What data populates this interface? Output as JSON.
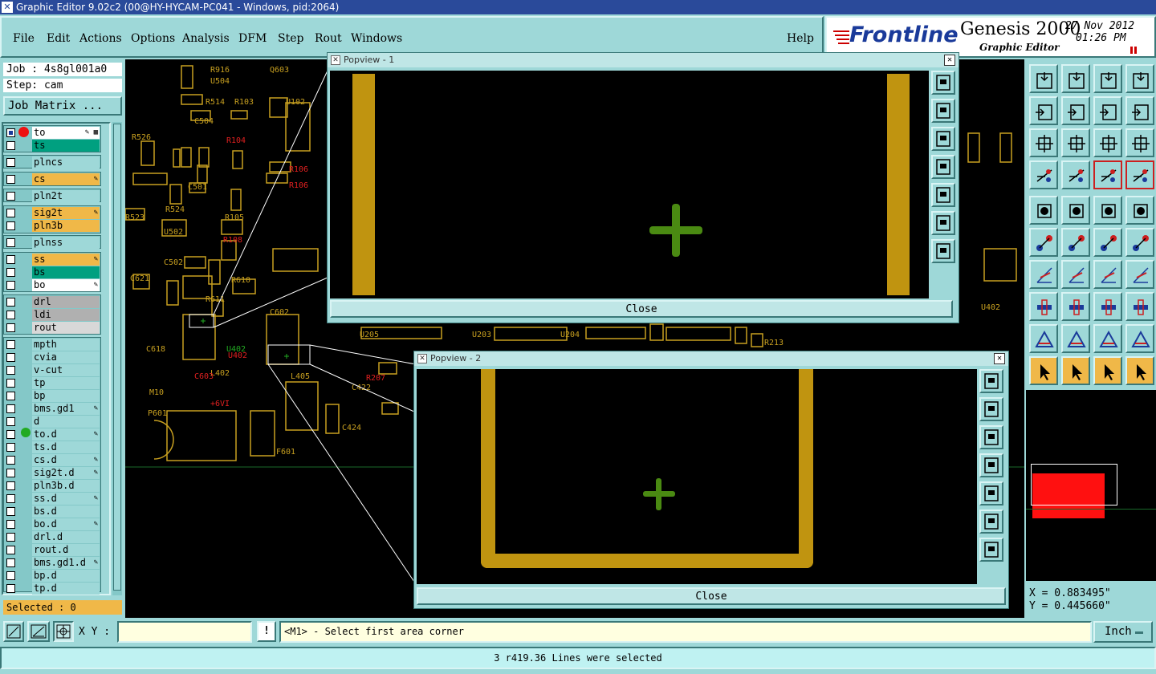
{
  "window_title": "Graphic Editor 9.02c2 (00@HY-HYCAM-PC041 - Windows, pid:2064)",
  "menu": [
    "File",
    "Edit",
    "Actions",
    "Options",
    "Analysis",
    "DFM",
    "Step",
    "Rout",
    "Windows"
  ],
  "help_label": "Help",
  "brand": {
    "logo": "Frontline",
    "product": "Genesis 2000",
    "subtitle": "Graphic Editor",
    "date": "27 Nov 2012",
    "time": "01:26 PM",
    "accent": "#cc0000"
  },
  "job": {
    "job_label": "Job : 4s8gl001a0",
    "step_label": "Step: cam",
    "matrix_button": "Job Matrix ..."
  },
  "layers": [
    {
      "name": "to",
      "bg": "#ffffff",
      "edit": "✎ ▦"
    },
    {
      "name": "ts",
      "bg": "#00a080",
      "edit": ""
    },
    {
      "name": "plncs",
      "bg": "#9ed8d8",
      "edit": ""
    },
    {
      "name": "cs",
      "bg": "#f0b848",
      "edit": "✎"
    },
    {
      "name": "pln2t",
      "bg": "#9ed8d8",
      "edit": ""
    },
    {
      "name": "sig2t",
      "bg": "#f0b848",
      "edit": "✎"
    },
    {
      "name": "pln3b",
      "bg": "#f0b848",
      "edit": ""
    },
    {
      "name": "plnss",
      "bg": "#9ed8d8",
      "edit": ""
    },
    {
      "name": "ss",
      "bg": "#f0b848",
      "edit": "✎"
    },
    {
      "name": "bs",
      "bg": "#00a080",
      "edit": ""
    },
    {
      "name": "bo",
      "bg": "#ffffff",
      "edit": "✎"
    },
    {
      "name": "drl",
      "bg": "#b0b0b0",
      "edit": ""
    },
    {
      "name": "ldi",
      "bg": "#b0b0b0",
      "edit": ""
    },
    {
      "name": "rout",
      "bg": "#d8d8d8",
      "edit": ""
    },
    {
      "name": "mpth",
      "bg": "#9ed8d8",
      "edit": ""
    },
    {
      "name": "cvia",
      "bg": "#9ed8d8",
      "edit": ""
    },
    {
      "name": "v-cut",
      "bg": "#9ed8d8",
      "edit": ""
    },
    {
      "name": "tp",
      "bg": "#9ed8d8",
      "edit": ""
    },
    {
      "name": "bp",
      "bg": "#9ed8d8",
      "edit": ""
    },
    {
      "name": "bms.gd1",
      "bg": "#9ed8d8",
      "edit": "✎"
    },
    {
      "name": "d",
      "bg": "#9ed8d8",
      "edit": ""
    },
    {
      "name": "to.d",
      "bg": "#9ed8d8",
      "edit": "✎"
    },
    {
      "name": "ts.d",
      "bg": "#9ed8d8",
      "edit": ""
    },
    {
      "name": "cs.d",
      "bg": "#9ed8d8",
      "edit": "✎"
    },
    {
      "name": "sig2t.d",
      "bg": "#9ed8d8",
      "edit": "✎"
    },
    {
      "name": "pln3b.d",
      "bg": "#9ed8d8",
      "edit": ""
    },
    {
      "name": "ss.d",
      "bg": "#9ed8d8",
      "edit": "✎"
    },
    {
      "name": "bs.d",
      "bg": "#9ed8d8",
      "edit": ""
    },
    {
      "name": "bo.d",
      "bg": "#9ed8d8",
      "edit": "✎"
    },
    {
      "name": "drl.d",
      "bg": "#9ed8d8",
      "edit": ""
    },
    {
      "name": "rout.d",
      "bg": "#9ed8d8",
      "edit": ""
    },
    {
      "name": "bms.gd1.d",
      "bg": "#9ed8d8",
      "edit": "✎"
    },
    {
      "name": "bp.d",
      "bg": "#9ed8d8",
      "edit": ""
    },
    {
      "name": "tp.d",
      "bg": "#9ed8d8",
      "edit": ""
    }
  ],
  "selected_label": "Selected : 0",
  "popview1": {
    "title": "Popview - 1",
    "close_label": "Close"
  },
  "popview2": {
    "title": "Popview - 2",
    "close_label": "Close"
  },
  "coords": {
    "x": "X = 0.883495\"",
    "y": "Y = 0.445660\""
  },
  "bottom": {
    "xy_label": "X Y :",
    "xy_value": "",
    "prompt": "<M1> - Select first area corner",
    "unit": "Inch"
  },
  "status_text": "3 r419.36 Lines were selected",
  "pcb_labels": [
    {
      "t": "R916",
      "c": "y"
    },
    {
      "t": "U504",
      "c": "y"
    },
    {
      "t": "Q603",
      "c": "y"
    },
    {
      "t": "R514",
      "c": "y"
    },
    {
      "t": "R103",
      "c": "y"
    },
    {
      "t": "U102",
      "c": "y"
    },
    {
      "t": "C504",
      "c": "y"
    },
    {
      "t": "C507",
      "c": "y"
    },
    {
      "t": "C527",
      "c": "r"
    },
    {
      "t": "C506",
      "c": "g"
    },
    {
      "t": "R104",
      "c": "y"
    },
    {
      "t": "R105",
      "c": "r"
    },
    {
      "t": "R526",
      "c": "y"
    },
    {
      "t": "C501",
      "c": "y"
    },
    {
      "t": "R106",
      "c": "r"
    },
    {
      "t": "R524",
      "c": "y"
    },
    {
      "t": "R105",
      "c": "y"
    },
    {
      "t": "R523",
      "c": "y"
    },
    {
      "t": "U502",
      "c": "y"
    },
    {
      "t": "R108",
      "c": "r"
    },
    {
      "t": "C502",
      "c": "y"
    },
    {
      "t": "R610",
      "c": "y"
    },
    {
      "t": "C621",
      "c": "y"
    },
    {
      "t": "R611",
      "c": "y"
    },
    {
      "t": "C619",
      "c": "y"
    },
    {
      "t": "C618",
      "c": "y"
    },
    {
      "t": "U402",
      "c": "g"
    },
    {
      "t": "U402",
      "c": "r"
    },
    {
      "t": "L402",
      "c": "y"
    },
    {
      "t": "C603",
      "c": "r"
    },
    {
      "t": "L405",
      "c": "y"
    },
    {
      "t": "M10",
      "c": "y"
    },
    {
      "t": "P601",
      "c": "y"
    },
    {
      "t": "R207",
      "c": "r"
    },
    {
      "t": "C422",
      "c": "y"
    },
    {
      "t": "C424",
      "c": "y"
    },
    {
      "t": "F601",
      "c": "y"
    },
    {
      "t": "U205",
      "c": "y"
    },
    {
      "t": "U203",
      "c": "y"
    },
    {
      "t": "U204",
      "c": "y"
    },
    {
      "t": "R213",
      "c": "y"
    },
    {
      "t": "U402",
      "c": "y"
    },
    {
      "t": "+6VI",
      "c": "r"
    },
    {
      "t": "C602",
      "c": "y"
    }
  ]
}
